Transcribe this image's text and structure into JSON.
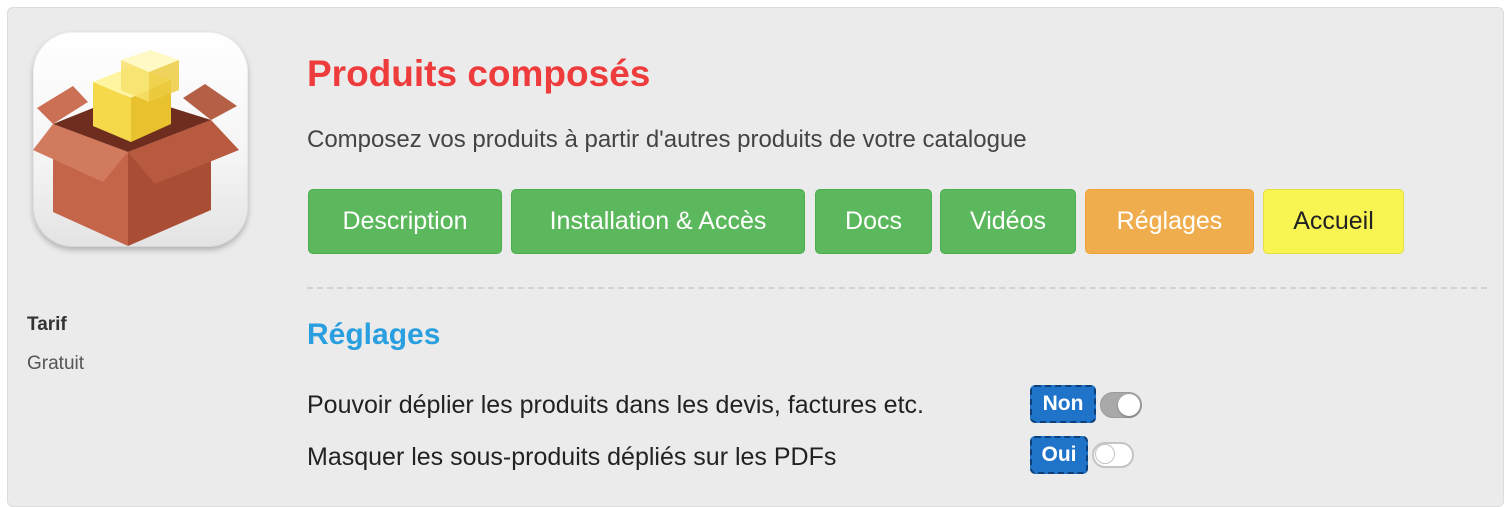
{
  "module": {
    "title": "Produits composés",
    "subtitle": "Composez vos produits à partir d'autres produits de votre catalogue",
    "icon": "package-box-icon"
  },
  "pricing": {
    "label": "Tarif",
    "value": "Gratuit"
  },
  "tabs": [
    {
      "label": "Description",
      "style": "green"
    },
    {
      "label": "Installation & Accès",
      "style": "green"
    },
    {
      "label": "Docs",
      "style": "green"
    },
    {
      "label": "Vidéos",
      "style": "green"
    },
    {
      "label": "Réglages",
      "style": "orange"
    },
    {
      "label": "Accueil",
      "style": "yellow"
    }
  ],
  "settings": {
    "title": "Réglages",
    "items": [
      {
        "label": "Pouvoir déplier les produits dans les devis, factures etc.",
        "badge": "Non",
        "toggle_on": true
      },
      {
        "label": "Masquer les sous-produits dépliés sur les PDFs",
        "badge": "Oui",
        "toggle_on": false
      }
    ]
  },
  "colors": {
    "title": "#ee3b3b",
    "section_title": "#2a9fe0",
    "green": "#5cb85c",
    "orange": "#f0ad4e",
    "yellow": "#f8f552",
    "badge": "#1f73c8"
  }
}
